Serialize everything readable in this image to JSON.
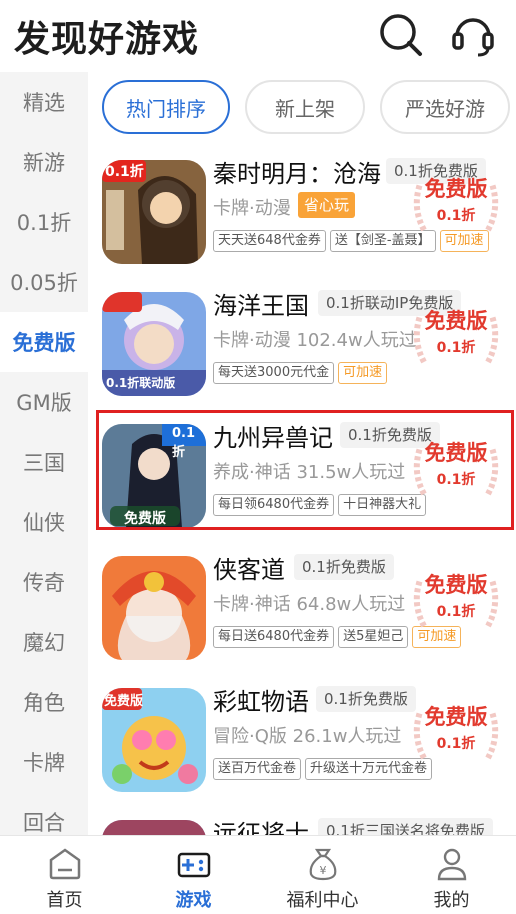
{
  "header": {
    "title": "发现好游戏",
    "search_icon": "search-icon",
    "service_icon": "headset-icon"
  },
  "sidebar": {
    "items": [
      {
        "label": "精选"
      },
      {
        "label": "新游"
      },
      {
        "label": "0.1折"
      },
      {
        "label": "0.05折"
      },
      {
        "label": "免费版",
        "active": true
      },
      {
        "label": "GM版"
      },
      {
        "label": "三国"
      },
      {
        "label": "仙侠"
      },
      {
        "label": "传奇"
      },
      {
        "label": "魔幻"
      },
      {
        "label": "角色"
      },
      {
        "label": "卡牌"
      },
      {
        "label": "回合"
      }
    ]
  },
  "tabs": [
    {
      "label": "热门排序",
      "active": true
    },
    {
      "label": "新上架"
    },
    {
      "label": "严选好游"
    }
  ],
  "games": [
    {
      "name": "秦时明月：沧海",
      "badge": "0.1折免费版",
      "meta": "卡牌·动漫",
      "extra_tag": "省心玩",
      "tags": [
        {
          "text": "天天送648代金券"
        },
        {
          "text": "送【剑圣-盖聂】"
        },
        {
          "text": "可加速",
          "orange": true
        }
      ],
      "stamp": {
        "title": "免费版",
        "sub": "0.1折"
      },
      "icon_label": "0.1折"
    },
    {
      "name": "海洋王国",
      "badge": "0.1折联动IP免费版",
      "meta": "卡牌·动漫  102.4w人玩过",
      "tags": [
        {
          "text": "每天送3000元代金"
        },
        {
          "text": "可加速",
          "orange": true
        }
      ],
      "stamp": {
        "title": "免费版",
        "sub": "0.1折"
      },
      "icon_label": "0.1折联动版"
    },
    {
      "name": "九州异兽记",
      "badge": "0.1折免费版",
      "meta": "养成·神话  31.5w人玩过",
      "tags": [
        {
          "text": "每日领6480代金券"
        },
        {
          "text": "十日神器大礼"
        }
      ],
      "stamp": {
        "title": "免费版",
        "sub": "0.1折"
      },
      "icon_label": "免费版"
    },
    {
      "name": "侠客道",
      "badge": "0.1折免费版",
      "meta": "卡牌·神话  64.8w人玩过",
      "tags": [
        {
          "text": "每日送6480代金券"
        },
        {
          "text": "送5星妲己"
        },
        {
          "text": "可加速",
          "orange": true
        }
      ],
      "stamp": {
        "title": "免费版",
        "sub": "0.1折"
      }
    },
    {
      "name": "彩虹物语",
      "badge": "0.1折免费版",
      "meta": "冒险·Q版  26.1w人玩过",
      "tags": [
        {
          "text": "送百万代金卷"
        },
        {
          "text": "升级送十万元代金卷"
        }
      ],
      "stamp": {
        "title": "免费版",
        "sub": "0.1折"
      },
      "icon_label": "免费版"
    },
    {
      "name": "远征将士",
      "badge": "0.1折三国送名将免费版"
    }
  ],
  "bottom_nav": [
    {
      "label": "首页",
      "icon": "home-icon"
    },
    {
      "label": "游戏",
      "icon": "gamepad-icon",
      "active": true
    },
    {
      "label": "福利中心",
      "icon": "gift-bag-icon"
    },
    {
      "label": "我的",
      "icon": "user-icon"
    }
  ],
  "colors": {
    "accent": "#2a6fd6",
    "stamp_red": "#e23a2e",
    "orange": "#f9a338",
    "highlight": "#e02020"
  }
}
